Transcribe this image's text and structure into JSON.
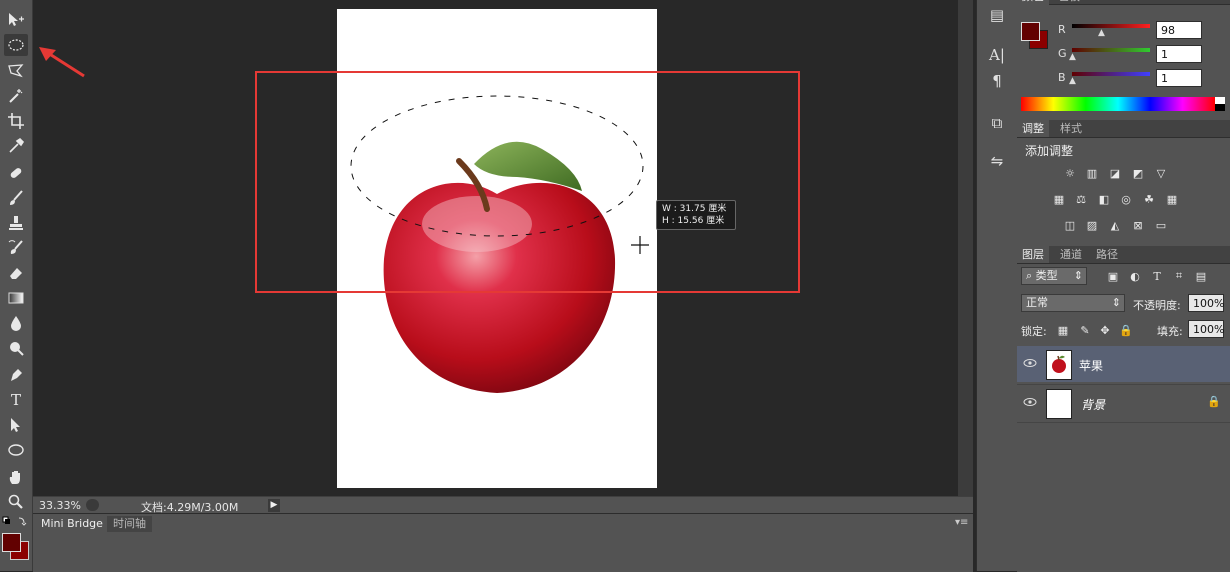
{
  "canvas": {
    "transform_readout": {
      "w_label": "W :",
      "w_value": "31.75",
      "w_unit": "厘米",
      "h_label": "H :",
      "h_value": "15.56",
      "h_unit": "厘米"
    },
    "colors": {
      "annotation_red": "#e53935",
      "foreground": "#620101",
      "background": "#8b0000"
    }
  },
  "status": {
    "zoom": "33.33%",
    "doc_info": "文档:4.29M/3.00M"
  },
  "bottom_panel": {
    "tabs": [
      "Mini Bridge",
      "时间轴"
    ]
  },
  "color_panel": {
    "tabs": [
      "颜色",
      "色板"
    ],
    "channels": [
      {
        "label": "R",
        "value": "98",
        "color": "#ff2020"
      },
      {
        "label": "G",
        "value": "1",
        "color": "#33cc33"
      },
      {
        "label": "B",
        "value": "1",
        "color": "#3333ff"
      }
    ]
  },
  "adjust_panel": {
    "tabs": [
      "调整",
      "样式"
    ],
    "title": "添加调整"
  },
  "layers_panel": {
    "tabs": [
      "图层",
      "通道",
      "路径"
    ],
    "filter_label": "类型",
    "blend_mode": "正常",
    "opacity_label": "不透明度:",
    "opacity_value": "100%",
    "lock_label": "锁定:",
    "fill_label": "填充:",
    "fill_value": "100%",
    "layers": [
      {
        "name": "苹果",
        "selected": true
      },
      {
        "name": "背景",
        "selected": false,
        "locked": true
      }
    ]
  },
  "icons": {
    "toolbar": [
      "move-tool-icon",
      "ellipse-marquee-icon",
      "polygon-lasso-icon",
      "magic-wand-icon",
      "crop-icon",
      "eyedropper-icon",
      "healing-brush-icon",
      "brush-icon",
      "clone-stamp-icon",
      "history-brush-icon",
      "eraser-icon",
      "gradient-icon",
      "blur-icon",
      "dodge-icon",
      "pen-icon",
      "type-icon",
      "path-select-icon",
      "ellipse-shape-icon",
      "hand-icon",
      "zoom-icon"
    ]
  }
}
